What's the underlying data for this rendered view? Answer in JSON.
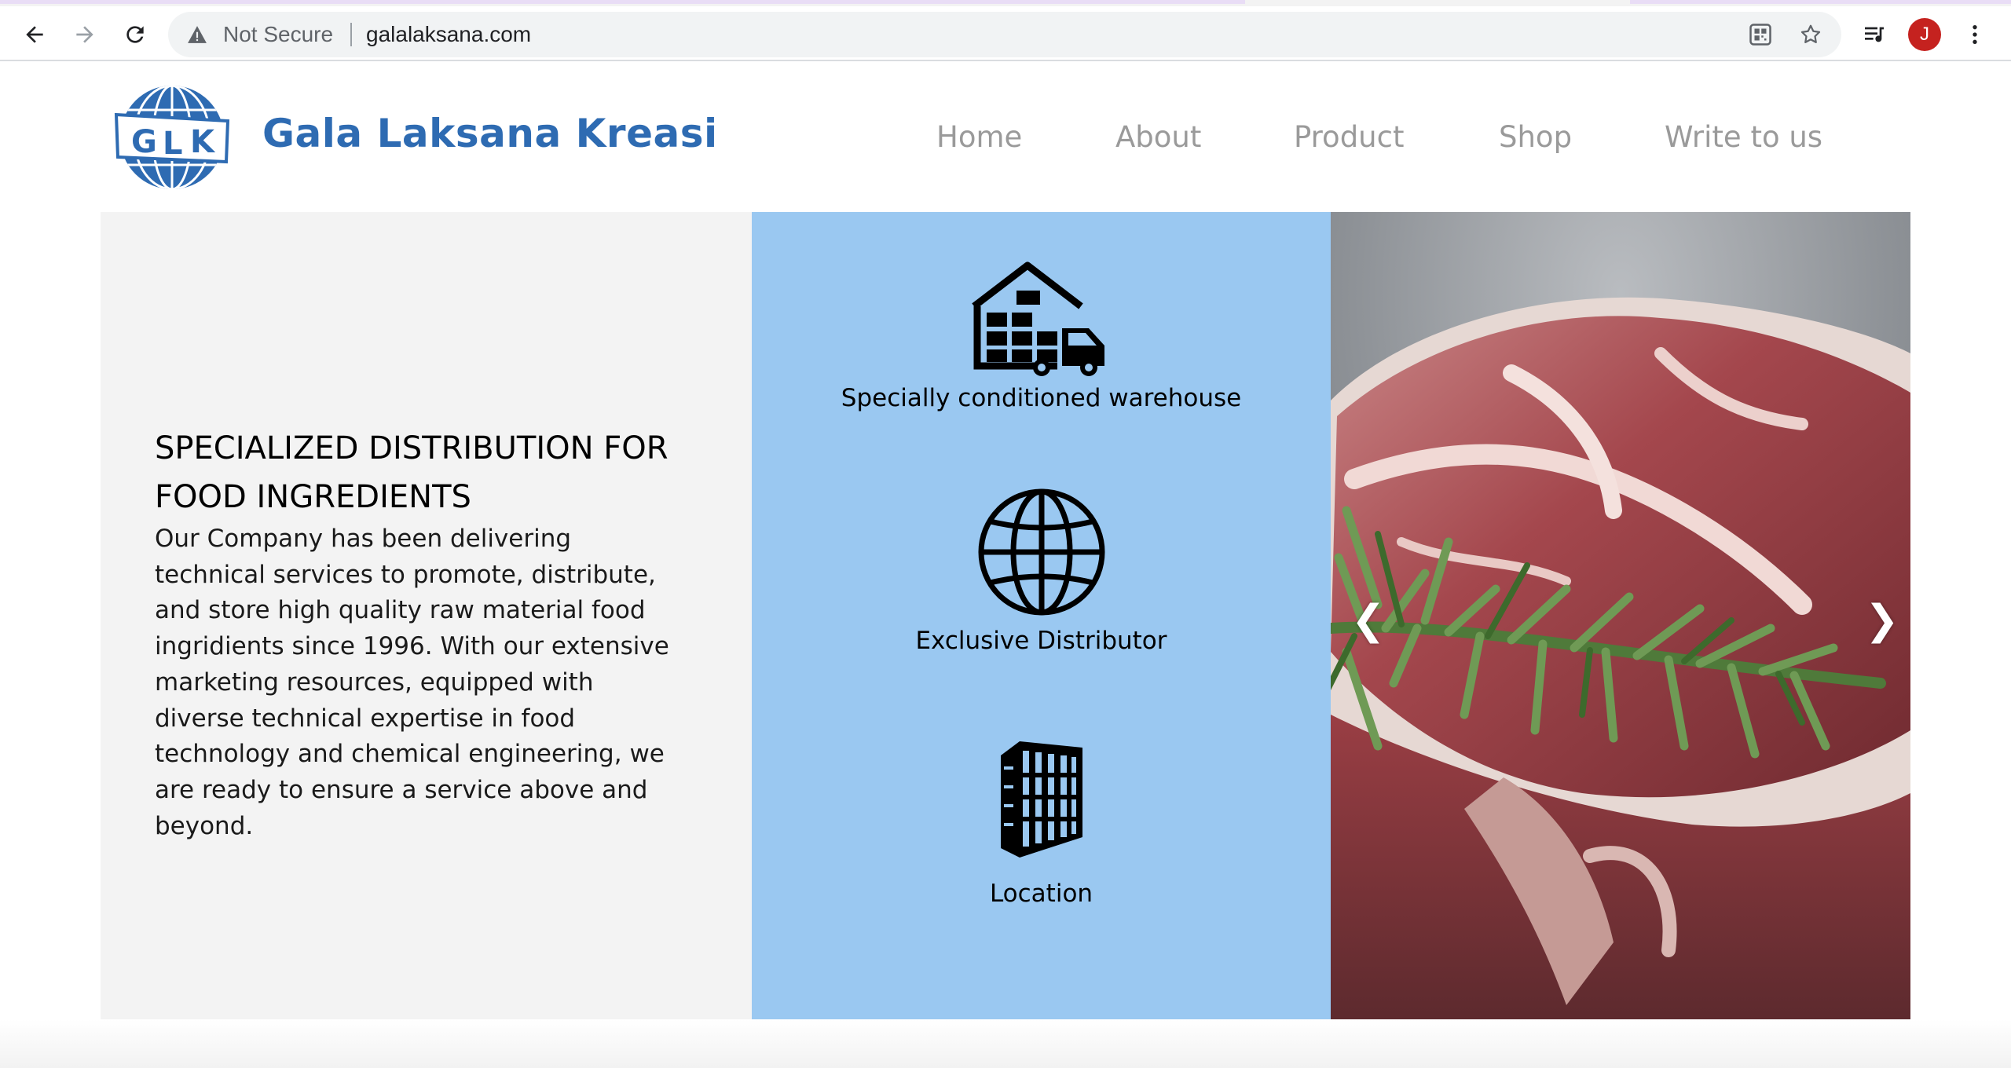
{
  "browser": {
    "security_label": "Not Secure",
    "url": "galalaksana.com",
    "profile_initial": "J",
    "icons": {
      "back": "arrow-left-icon",
      "forward": "arrow-right-icon",
      "reload": "reload-icon",
      "warning": "warning-triangle-icon",
      "qr": "qr-code-icon",
      "bookmark": "star-icon",
      "media": "media-queue-icon",
      "menu": "kebab-menu-icon"
    }
  },
  "site": {
    "brand": "Gala Laksana Kreasi",
    "logo_letters": [
      "G",
      "L",
      "K"
    ],
    "nav": [
      "Home",
      "About",
      "Product",
      "Shop",
      "Write to us"
    ]
  },
  "hero": {
    "title": "SPECIALIZED DISTRIBUTION FOR FOOD INGREDIENTS",
    "body": "Our Company has been delivering technical services to promote, distribute, and store high quality raw material food ingridients since 1996. With our extensive marketing resources, equipped with diverse technical expertise in food technology and chemical engineering, we are ready to ensure a service above and beyond."
  },
  "features": [
    {
      "label": "Specially conditioned warehouse",
      "icon": "warehouse-truck-icon"
    },
    {
      "label": "Exclusive Distributor",
      "icon": "globe-icon"
    },
    {
      "label": "Location",
      "icon": "building-icon"
    }
  ],
  "carousel": {
    "prev": "❮",
    "next": "❯",
    "image": "raw-steak-with-rosemary-photo"
  },
  "colors": {
    "brand_blue": "#2e6bb2",
    "feature_panel": "#9ac8f1",
    "text_panel": "#f3f3f3",
    "nav_text": "#9a9a9a",
    "avatar": "#c5221f"
  }
}
